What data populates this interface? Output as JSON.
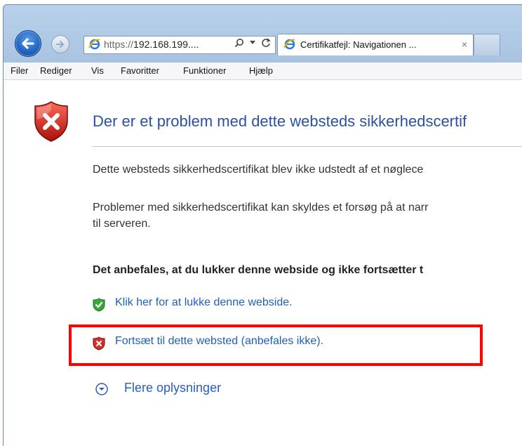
{
  "browser": {
    "address": {
      "protocol": "https://",
      "host_text": "192.168.199...."
    },
    "tab": {
      "title": "Certifikatfejl: Navigationen ...",
      "close": "×"
    }
  },
  "menu": [
    "Filer",
    "Rediger",
    "Vis",
    "Favoritter",
    "Funktioner",
    "Hjælp"
  ],
  "page": {
    "heading": "Der er et problem med dette websteds sikkerhedscertif",
    "para1": "Dette websteds sikkerhedscertifikat blev ikke udstedt af et nøglece",
    "para2_line1": "Problemer med sikkerhedscertifikat kan skyldes et forsøg på at narr",
    "para2_line2": "til serveren.",
    "recommendation": "Det anbefales, at du lukker denne webside og ikke fortsætter t",
    "close_link": "Klik her for at lukke denne webside.",
    "continue_link": "Fortsæt til dette websted (anbefales ikke).",
    "more_info": "Flere oplysninger"
  },
  "colors": {
    "highlight": "#ff0000",
    "link": "#1f5fb8",
    "heading": "#2a52a0"
  },
  "icons": [
    "back-icon",
    "forward-icon",
    "ie-logo-icon",
    "search-icon",
    "refresh-icon",
    "error-shield-icon",
    "green-shield-icon",
    "red-shield-icon",
    "expand-chevron-icon"
  ]
}
